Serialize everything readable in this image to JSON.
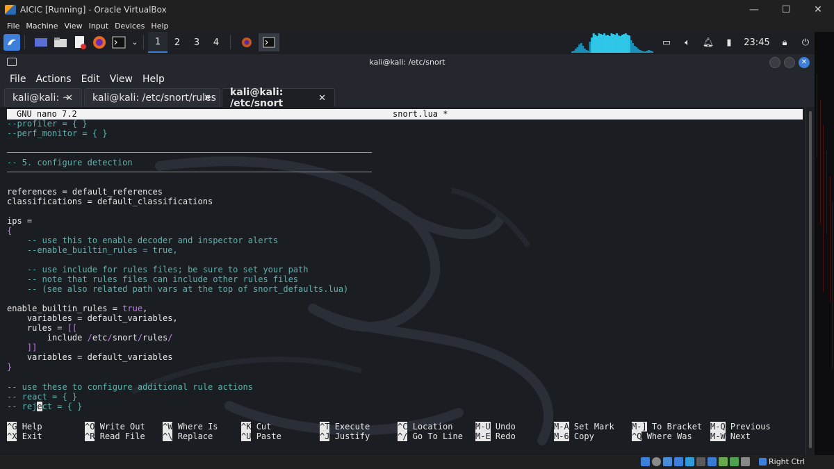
{
  "vbox": {
    "title": "AICIC [Running] - Oracle VirtualBox",
    "menu": [
      "File",
      "Machine",
      "View",
      "Input",
      "Devices",
      "Help"
    ],
    "host_key": "Right Ctrl",
    "controls": {
      "minimize": "—",
      "maximize": "☐",
      "close": "✕"
    }
  },
  "panel": {
    "workspaces": [
      "1",
      "2",
      "3",
      "4"
    ],
    "active_workspace": "1",
    "clock": "23:45"
  },
  "terminal": {
    "title": "kali@kali: /etc/snort",
    "menu": [
      "File",
      "Actions",
      "Edit",
      "View",
      "Help"
    ],
    "tabs": [
      {
        "label": "kali@kali: ~",
        "close": "✕"
      },
      {
        "label": "kali@kali: /etc/snort/rules",
        "close": "✕"
      },
      {
        "label": "kali@kali: /etc/snort",
        "close": "✕"
      }
    ],
    "active_tab": 2
  },
  "nano": {
    "header_left": "GNU nano 7.2",
    "header_center": "snort.lua *",
    "lines": {
      "l1": "--profiler = { }",
      "l2": "--perf_monitor = { }",
      "l4": "-- 5. configure detection",
      "l7": "references = default_references",
      "l8": "classifications = default_classifications",
      "l10": "ips =",
      "l11": "{",
      "l12": "    -- use this to enable decoder and inspector alerts",
      "l13": "    --enable_builtin_rules = true,",
      "l15": "    -- use include for rules files; be sure to set your path",
      "l16": "    -- note that rules files can include other rules files",
      "l17": "    -- (see also related path vars at the top of snort_defaults.lua)",
      "l19a": "enable_builtin_rules = ",
      "l19b": "true",
      "l19c": ",",
      "l20": "    variables = default_variables,",
      "l21a": "    rules = ",
      "l21b": "[[",
      "l22a": "        include ",
      "l22b": "/",
      "l22c": "etc",
      "l22d": "/",
      "l22e": "snort",
      "l22f": "/",
      "l22g": "rules",
      "l22h": "/",
      "l23": "    ]]",
      "l24": "    variables = default_variables",
      "l25": "}",
      "l27": "-- use these to configure additional rule actions",
      "l28": "-- react = { }",
      "l29a": "-- rej",
      "l29b": "e",
      "l29c": "ct = { }"
    },
    "shortcuts": [
      {
        "key": "^G",
        "label": "Help"
      },
      {
        "key": "^X",
        "label": "Exit"
      },
      {
        "key": "^O",
        "label": "Write Out"
      },
      {
        "key": "^R",
        "label": "Read File"
      },
      {
        "key": "^W",
        "label": "Where Is"
      },
      {
        "key": "^\\",
        "label": "Replace"
      },
      {
        "key": "^K",
        "label": "Cut"
      },
      {
        "key": "^U",
        "label": "Paste"
      },
      {
        "key": "^T",
        "label": "Execute"
      },
      {
        "key": "^J",
        "label": "Justify"
      },
      {
        "key": "^C",
        "label": "Location"
      },
      {
        "key": "^/",
        "label": "Go To Line"
      },
      {
        "key": "M-U",
        "label": "Undo"
      },
      {
        "key": "M-E",
        "label": "Redo"
      },
      {
        "key": "M-A",
        "label": "Set Mark"
      },
      {
        "key": "M-6",
        "label": "Copy"
      },
      {
        "key": "M-]",
        "label": "To Bracket"
      },
      {
        "key": "^Q",
        "label": "Where Was"
      },
      {
        "key": "M-Q",
        "label": "Previous"
      },
      {
        "key": "M-W",
        "label": "Next"
      }
    ]
  },
  "colors": {
    "comment": "#5fb3ac",
    "keyword": "#c47ee8",
    "kali_blue": "#3d7fd9",
    "terminal_bg": "#1a1d22"
  }
}
